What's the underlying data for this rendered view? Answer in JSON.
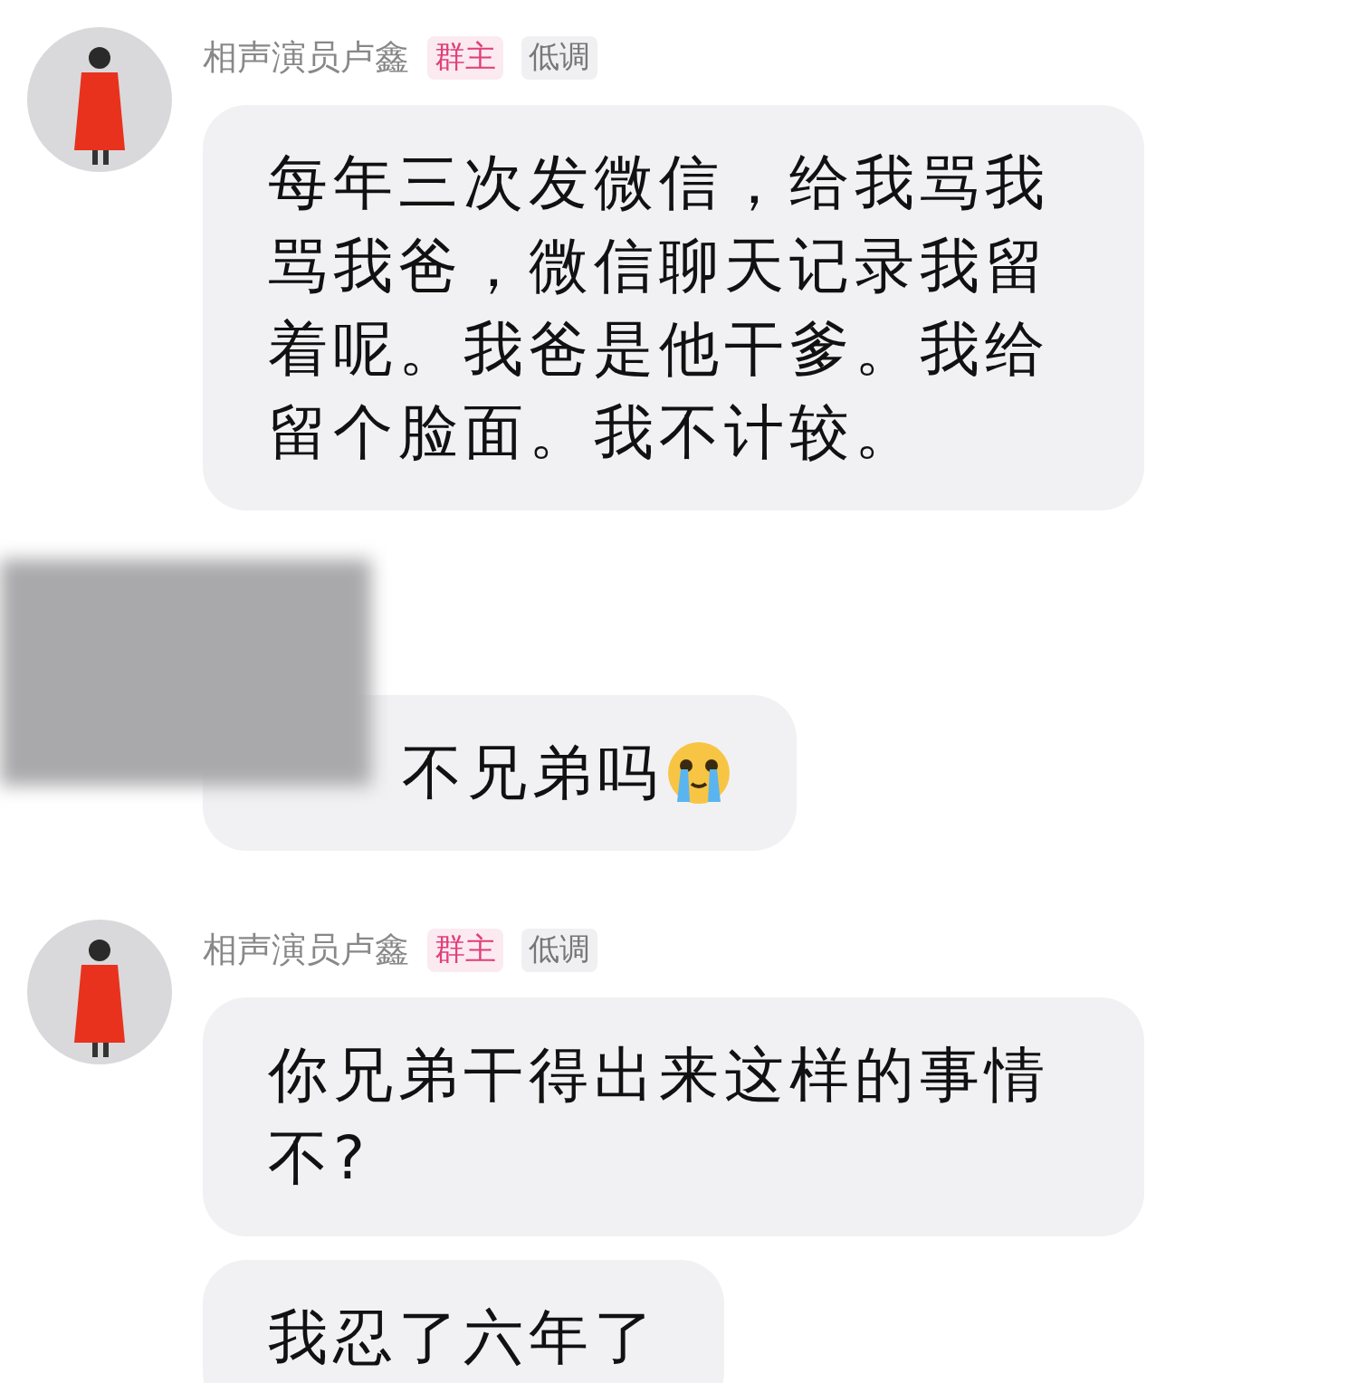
{
  "messages": [
    {
      "kind": "group",
      "sender": "相声演员卢鑫",
      "badges": [
        {
          "kind": "owner",
          "label": "群主"
        },
        {
          "kind": "plain",
          "label": "低调"
        }
      ],
      "bubbles": [
        {
          "text": "每年三次发微信，给我骂我骂我爸，微信聊天记录我留着呢。我爸是他干爹。我给留个脸面。我不计较。"
        }
      ]
    },
    {
      "kind": "redacted",
      "bubbles": [
        {
          "kind": "emoji_end",
          "text": "不兄弟吗"
        }
      ]
    },
    {
      "kind": "group",
      "sender": "相声演员卢鑫",
      "badges": [
        {
          "kind": "owner",
          "label": "群主"
        },
        {
          "kind": "plain",
          "label": "低调"
        }
      ],
      "bubbles": [
        {
          "text": "你兄弟干得出来这样的事情不?"
        },
        {
          "text": "我忍了六年了"
        }
      ]
    }
  ]
}
